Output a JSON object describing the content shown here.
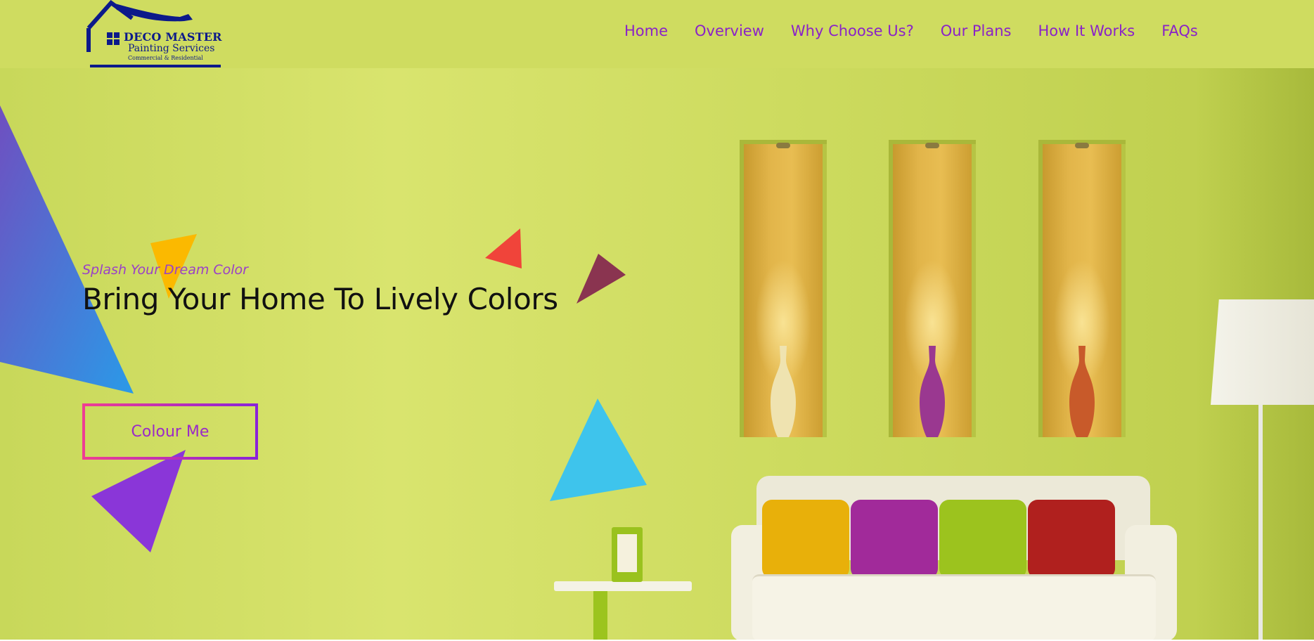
{
  "header": {
    "logo": {
      "line1": "DECO MASTER",
      "line2": "Painting Services",
      "line3": "Commercial & Residential",
      "color": "#0c1a8a"
    },
    "nav": [
      {
        "label": "Home"
      },
      {
        "label": "Overview"
      },
      {
        "label": "Why Choose Us?"
      },
      {
        "label": "Our Plans"
      },
      {
        "label": "How It Works"
      },
      {
        "label": "FAQs"
      }
    ],
    "nav_color": "#8a22c8",
    "background": "#cfdc60"
  },
  "hero": {
    "tagline": "Splash Your Dream Color",
    "headline": "Bring Your Home To Lively Colors",
    "cta_label": "Colour Me",
    "wall_color": "#d4e065",
    "pillow_colors": [
      "#e8b00a",
      "#a12a9a",
      "#9cc31e",
      "#b0201e"
    ],
    "vase_colors": [
      "#efe3b0",
      "#9a3890",
      "#c85a2a"
    ],
    "triangle_colors": [
      "#fbb900",
      "#f0443a",
      "#8a3450",
      "#3ec4ec",
      "#8a36d8",
      "#3a8ce0"
    ]
  }
}
